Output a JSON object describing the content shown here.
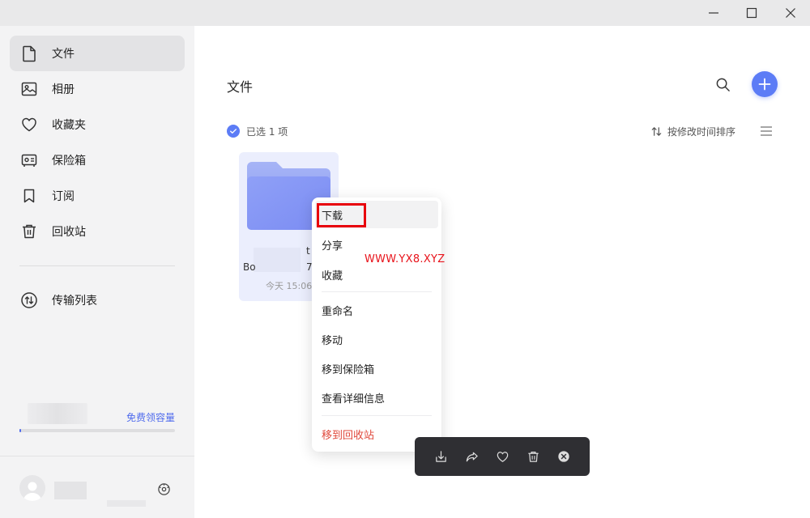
{
  "titlebar": {
    "icons": [
      "minimize-icon",
      "maximize-icon",
      "close-icon"
    ]
  },
  "sidebar": {
    "items": [
      {
        "label": "文件",
        "icon": "file-icon",
        "active": true
      },
      {
        "label": "相册",
        "icon": "photo-icon",
        "active": false
      },
      {
        "label": "收藏夹",
        "icon": "heart-icon",
        "active": false
      },
      {
        "label": "保险箱",
        "icon": "safe-icon",
        "active": false
      },
      {
        "label": "订阅",
        "icon": "bookmark-icon",
        "active": false
      },
      {
        "label": "回收站",
        "icon": "trash-icon",
        "active": false
      }
    ],
    "transfer": {
      "label": "传输列表",
      "icon": "transfer-icon"
    },
    "quota_link": "免费领容量"
  },
  "main": {
    "title": "文件",
    "selection_text": "已选 1 项",
    "sort_label": "按修改时间排序"
  },
  "file": {
    "name_left": "Bo",
    "name_right_top": "t",
    "name_right_bottom": "7",
    "date": "今天 15:06"
  },
  "context_menu": {
    "items": [
      {
        "label": "下载"
      },
      {
        "label": "分享"
      },
      {
        "label": "收藏"
      },
      {
        "label": "重命名"
      },
      {
        "label": "移动"
      },
      {
        "label": "移到保险箱"
      },
      {
        "label": "查看详细信息"
      },
      {
        "label": "移到回收站",
        "danger": true
      }
    ]
  },
  "watermark": "WWW.YX8.XYZ",
  "colors": {
    "accent": "#5c7cf6",
    "danger": "#e0493c",
    "highlight_box": "#e8000b"
  },
  "action_bar": {
    "icons": [
      "download-icon",
      "share-icon",
      "heart-icon",
      "trash-icon",
      "close-circle-icon"
    ]
  }
}
